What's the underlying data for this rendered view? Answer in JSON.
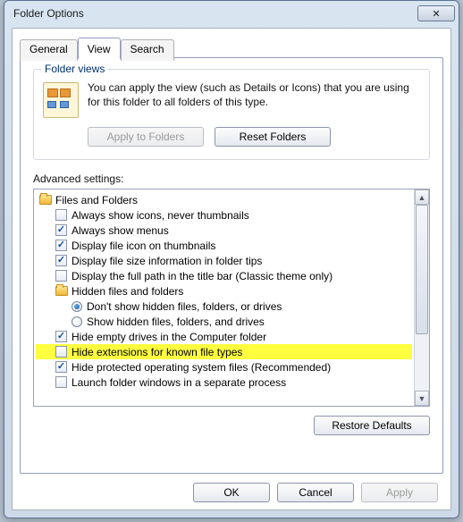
{
  "window": {
    "title": "Folder Options",
    "close": "✕"
  },
  "tabs": {
    "general": "General",
    "view": "View",
    "search": "Search"
  },
  "folder_views": {
    "group_title": "Folder views",
    "text": "You can apply the view (such as Details or Icons) that you are using for this folder to all folders of this type.",
    "apply": "Apply to Folders",
    "reset": "Reset Folders"
  },
  "advanced": {
    "label": "Advanced settings:",
    "root": "Files and Folders",
    "items": {
      "icons_never_thumb": "Always show icons, never thumbnails",
      "always_show_menus": "Always show menus",
      "file_icon_thumb": "Display file icon on thumbnails",
      "size_in_tips": "Display file size information in folder tips",
      "full_path_title": "Display the full path in the title bar (Classic theme only)",
      "hidden_group": "Hidden files and folders",
      "hidden_dont_show": "Don't show hidden files, folders, or drives",
      "hidden_show": "Show hidden files, folders, and drives",
      "hide_empty_drives": "Hide empty drives in the Computer folder",
      "hide_ext": "Hide extensions for known file types",
      "hide_protected": "Hide protected operating system files (Recommended)",
      "launch_separate": "Launch folder windows in a separate process"
    },
    "restore": "Restore Defaults"
  },
  "buttons": {
    "ok": "OK",
    "cancel": "Cancel",
    "apply": "Apply"
  }
}
